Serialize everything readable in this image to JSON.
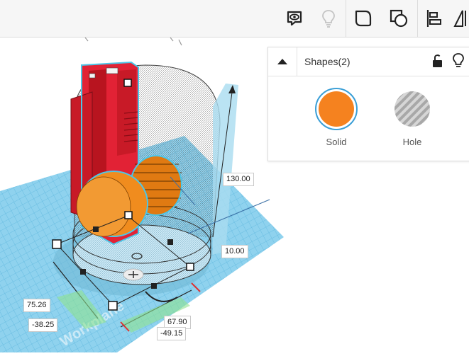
{
  "toolbar": {
    "icons": [
      "comment-eye-icon",
      "lightbulb-icon",
      "shape-outline-icon",
      "shape-union-icon",
      "align-icon",
      "mirror-icon"
    ]
  },
  "viewport": {
    "dimensions": {
      "height": "130.00",
      "elevation": "10.00",
      "width_y": "75.26",
      "pos_y": "-38.25",
      "width_x": "67.90",
      "pos_x": "-49.15"
    },
    "workplane_label": "Workplane"
  },
  "panel": {
    "title": "Shapes(2)",
    "solid": {
      "label": "Solid",
      "color": "#f5821f"
    },
    "hole": {
      "label": "Hole"
    }
  }
}
